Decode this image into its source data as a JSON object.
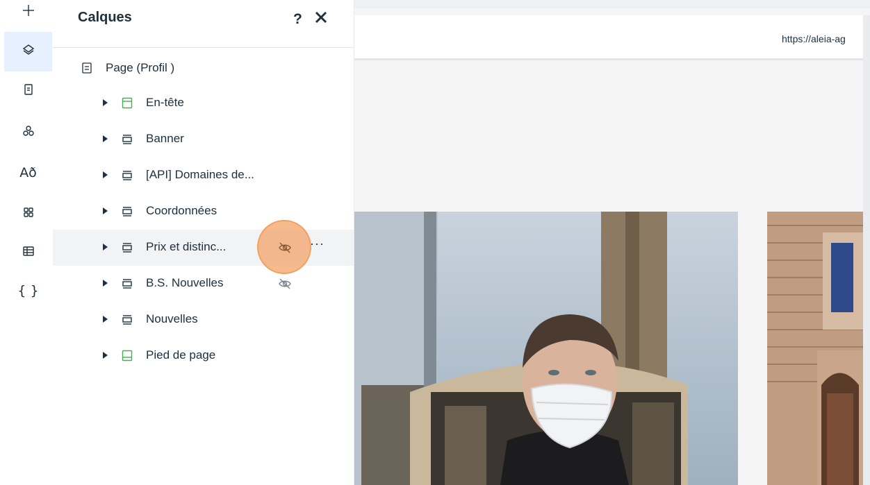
{
  "rail": {
    "items": [
      {
        "name": "add-icon"
      },
      {
        "name": "layers-icon",
        "active": true
      },
      {
        "name": "page-icon"
      },
      {
        "name": "apps-icon"
      },
      {
        "name": "theme-text-icon",
        "text": "Að"
      },
      {
        "name": "app-market-icon"
      },
      {
        "name": "table-icon"
      },
      {
        "name": "code-icon",
        "text": "{ }"
      }
    ]
  },
  "panel": {
    "title": "Calques",
    "help": "?",
    "page": {
      "label": "Page (Profil )"
    },
    "layers": [
      {
        "label": "En-tête",
        "icon": "header-section-icon",
        "color": "#3fb24e"
      },
      {
        "label": "Banner",
        "icon": "section-icon",
        "color": "#20303c"
      },
      {
        "label": "[API] Domaines de...",
        "icon": "section-icon",
        "color": "#20303c"
      },
      {
        "label": "Coordonnées",
        "icon": "section-icon",
        "color": "#20303c"
      },
      {
        "label": "Prix et distinc...",
        "icon": "section-icon",
        "color": "#20303c",
        "hidden": true,
        "hover": true,
        "more": "···"
      },
      {
        "label": "B.S. Nouvelles",
        "icon": "section-icon",
        "color": "#20303c",
        "hidden": true
      },
      {
        "label": "Nouvelles",
        "icon": "section-icon",
        "color": "#20303c"
      },
      {
        "label": "Pied de page",
        "icon": "footer-section-icon",
        "color": "#3fb24e"
      }
    ]
  },
  "canvas": {
    "url": "https://aleia-ag"
  },
  "colors": {
    "accent": "#e7f0ff",
    "highlight": "#f3a36a",
    "green_section": "#3fb24e"
  }
}
